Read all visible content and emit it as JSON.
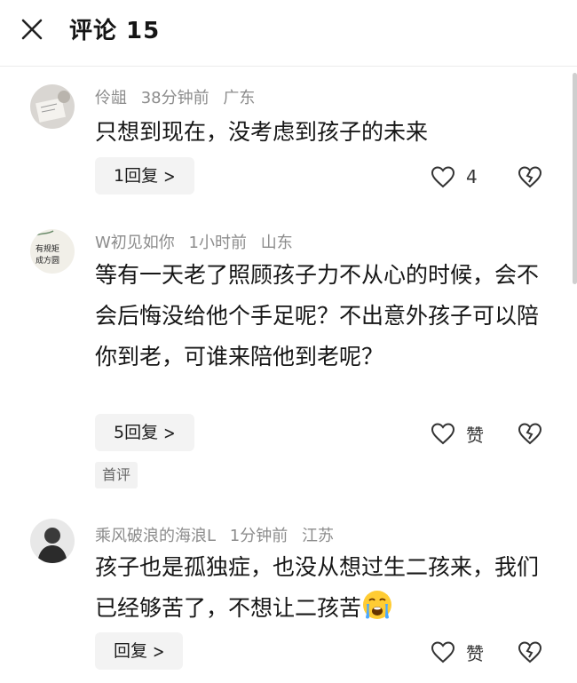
{
  "header": {
    "title": "评论 15"
  },
  "comments": [
    {
      "username": "伶龃",
      "time": "38分钟前",
      "location": "广东",
      "content": "只想到现在，没考虑到孩子的未来",
      "reply_label": "1回复",
      "like_label": "4",
      "badge": ""
    },
    {
      "username": "W初见如你",
      "time": "1小时前",
      "location": "山东",
      "content": "等有一天老了照顾孩子力不从心的时候，会不会后悔没给他个手足呢？不出意外孩子可以陪你到老，可谁来陪他到老呢？",
      "reply_label": "5回复",
      "like_label": "赞",
      "badge": "首评"
    },
    {
      "username": "乘风破浪的海浪L",
      "time": "1分钟前",
      "location": "江苏",
      "content": "孩子也是孤独症，也没从想过生二孩来，我们已经够苦了，不想让二孩苦",
      "reply_label": "回复",
      "like_label": "赞",
      "badge": ""
    }
  ],
  "icons": {
    "close": "close-icon",
    "like": "heart-outline-icon",
    "dislike": "broken-heart-icon",
    "reply_arrow": "chevron-right-icon",
    "emoji": "crying-face-emoji"
  },
  "colors": {
    "meta_text": "#8c8c8c",
    "button_bg": "#f3f3f3"
  }
}
